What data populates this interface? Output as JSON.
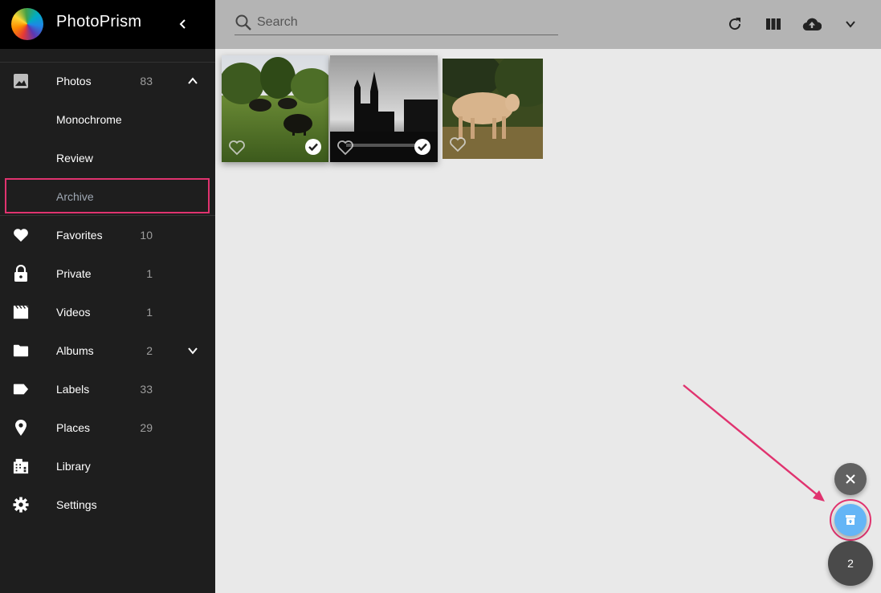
{
  "app": {
    "title": "PhotoPrism"
  },
  "sidebar": {
    "items": [
      {
        "label": "Photos",
        "count": "83",
        "icon": "image-icon"
      },
      {
        "label": "Monochrome"
      },
      {
        "label": "Review"
      },
      {
        "label": "Archive"
      },
      {
        "label": "Favorites",
        "count": "10",
        "icon": "heart-icon"
      },
      {
        "label": "Private",
        "count": "1",
        "icon": "lock-icon"
      },
      {
        "label": "Videos",
        "count": "1",
        "icon": "movie-icon"
      },
      {
        "label": "Albums",
        "count": "2",
        "icon": "folder-icon"
      },
      {
        "label": "Labels",
        "count": "33",
        "icon": "label-icon"
      },
      {
        "label": "Places",
        "count": "29",
        "icon": "place-icon"
      },
      {
        "label": "Library",
        "icon": "library-icon"
      },
      {
        "label": "Settings",
        "icon": "gear-icon"
      }
    ]
  },
  "toolbar": {
    "search_placeholder": "Search"
  },
  "photos": [
    {
      "subject": "buffalo grazing",
      "selected": true
    },
    {
      "subject": "bridge towers silhouette",
      "selected": true
    },
    {
      "subject": "cow in field",
      "selected": false
    }
  ],
  "fab": {
    "selection_count": "2"
  },
  "colors": {
    "accent": "#e0336f",
    "archive_button": "#64b5f6",
    "sidebar_bg": "#1e1e1e"
  }
}
